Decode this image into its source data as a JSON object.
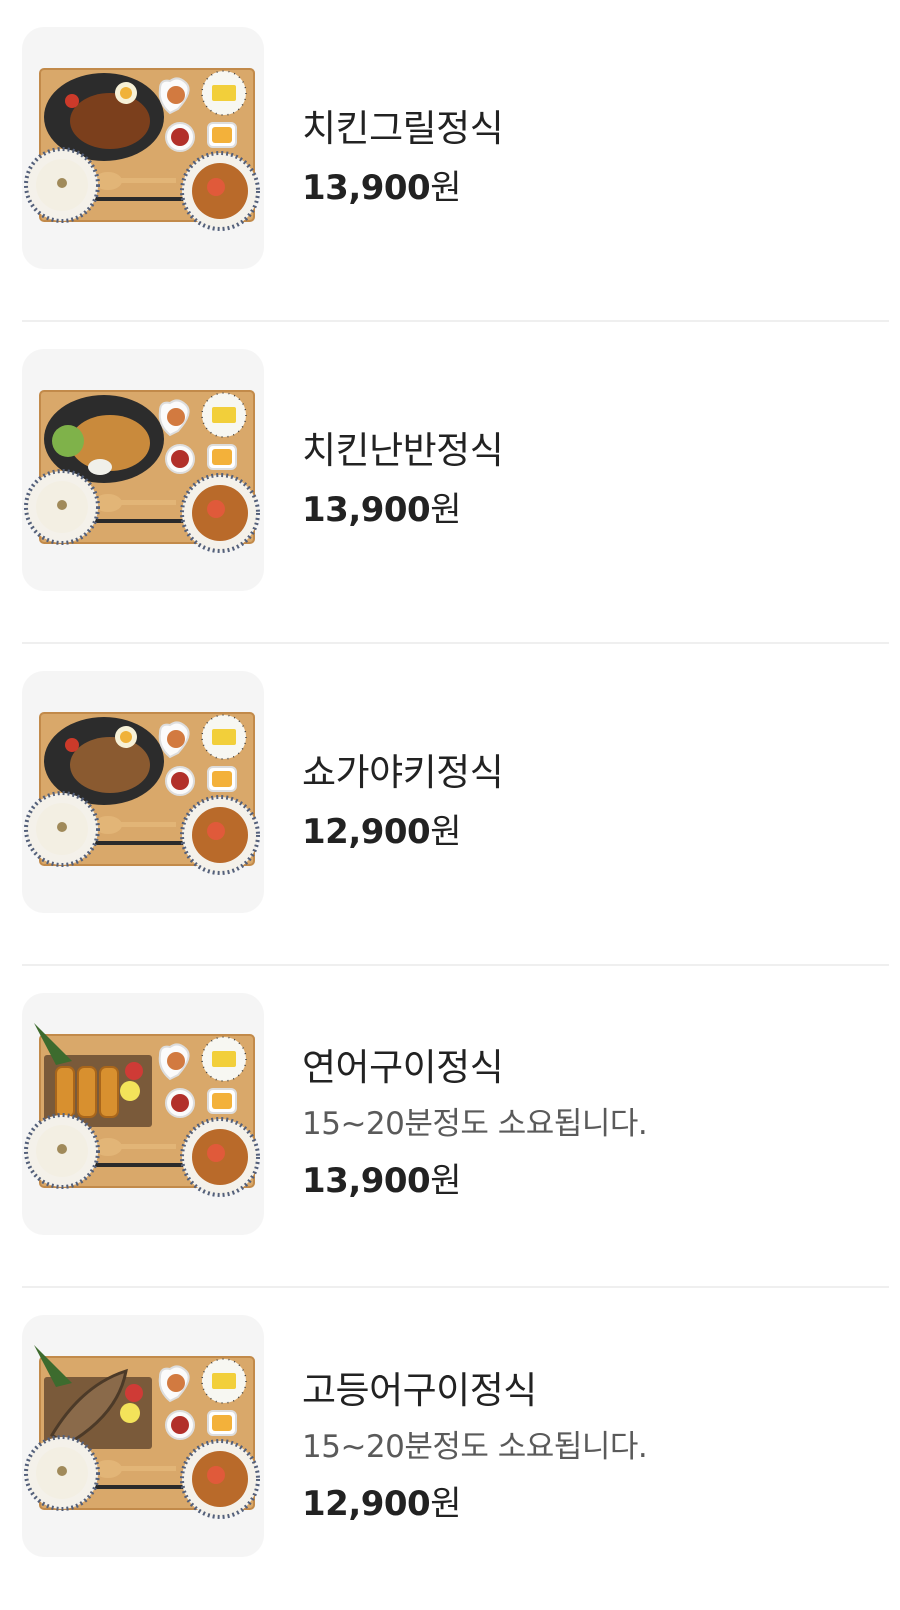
{
  "menu": {
    "items": [
      {
        "name": "치킨그릴정식",
        "description": "",
        "price": "13,900",
        "currency": "원",
        "image": "chicken-grill-set-image",
        "main_dish": "grilled-chicken"
      },
      {
        "name": "치킨난반정식",
        "description": "",
        "price": "13,900",
        "currency": "원",
        "image": "chicken-nanban-set-image",
        "main_dish": "fried-chicken"
      },
      {
        "name": "쇼가야키정식",
        "description": "",
        "price": "12,900",
        "currency": "원",
        "image": "shogayaki-set-image",
        "main_dish": "ginger-pork"
      },
      {
        "name": "연어구이정식",
        "description": "15~20분정도 소요됩니다.",
        "price": "13,900",
        "currency": "원",
        "image": "grilled-salmon-set-image",
        "main_dish": "salmon"
      },
      {
        "name": "고등어구이정식",
        "description": "15~20분정도 소요됩니다.",
        "price": "12,900",
        "currency": "원",
        "image": "grilled-mackerel-set-image",
        "main_dish": "mackerel"
      }
    ]
  },
  "colors": {
    "text_primary": "#222222",
    "text_secondary": "#5a5a5a",
    "divider": "#efefef",
    "thumb_background": "#f5f5f5",
    "tray_wood": "#d9a86a"
  }
}
